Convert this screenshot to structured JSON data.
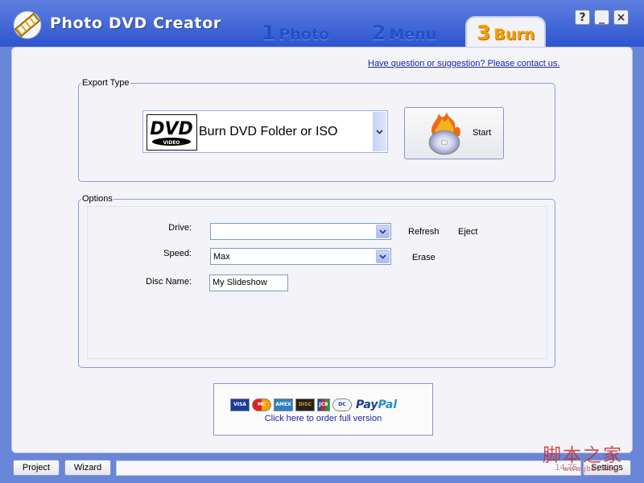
{
  "app": {
    "title": "Photo DVD Creator"
  },
  "tabs": [
    {
      "num": "1",
      "label": "Photo"
    },
    {
      "num": "2",
      "label": "Menu"
    },
    {
      "num": "3",
      "label": "Burn"
    }
  ],
  "window_controls": {
    "help": "?",
    "minimize": "_",
    "close": "×"
  },
  "contact_link": "Have question or suggestion? Please contact us.",
  "export": {
    "group_label": "Export Type",
    "selected": "Burn DVD Folder or ISO",
    "logo_text": "DVD",
    "logo_sub": "VIDEO",
    "start_label": "Start"
  },
  "options": {
    "group_label": "Options",
    "drive_label": "Drive:",
    "drive_value": "",
    "speed_label": "Speed:",
    "speed_value": "Max",
    "disc_name_label": "Disc Name:",
    "disc_name_value": "My Slideshow",
    "refresh": "Refresh",
    "eject": "Eject",
    "erase": "Erase"
  },
  "order": {
    "text": "Click here to order full version",
    "cards": [
      "VISA",
      "MC",
      "AMEX",
      "DISC",
      "JCB",
      "DC"
    ],
    "paypal_a": "Pay",
    "paypal_b": "Pal"
  },
  "footer": {
    "project": "Project",
    "wizard": "Wizard",
    "status": "14.75",
    "settings": "Settings"
  },
  "watermark": {
    "text": "脚本之家",
    "url": "www.jb51.net"
  },
  "colors": {
    "titlebar": "#3b60d6",
    "tab_active": "#f0a000",
    "link": "#1b24a8"
  }
}
